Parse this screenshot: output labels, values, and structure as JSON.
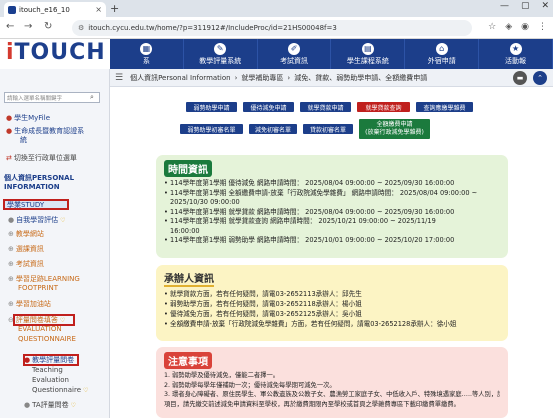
{
  "browser": {
    "tab_title": "itouch_e16_10",
    "url": "itouch.cycu.edu.tw/home/?p=311912#/IncludeProc/id=21HS00048f=3",
    "new_tab": "+",
    "win_min": "—",
    "win_max": "▢",
    "win_close": "✕"
  },
  "site": {
    "logo_i": "i",
    "logo_rest": "TOUCH",
    "nav": [
      {
        "label": "系",
        "icon": "▦"
      },
      {
        "label": "教學評量系統",
        "icon": "✎"
      },
      {
        "label": "考試資訊",
        "icon": "✐"
      },
      {
        "label": "學生課程系統",
        "icon": "▤"
      },
      {
        "label": "外宿申請",
        "icon": "⌂"
      },
      {
        "label": "活動報",
        "icon": "★"
      }
    ]
  },
  "sidebar": {
    "search_placeholder": "請輸入選單名稱關鍵字",
    "myfile": "學生MyFile",
    "portfolio_line1": "生命成長暨教育認證系",
    "portfolio_line2": "統",
    "switch_role": "切換至行政單位選單",
    "section_personal_1": "個人資訊PERSONAL",
    "section_personal_2": "INFORMATION",
    "study": "學業STUDY",
    "items": [
      "自我學習評估",
      "教學網站",
      "選課資訊",
      "考試資訊",
      "學習足跡LEARNING",
      "FOOTPRINT",
      "學習加油站",
      "評量問卷填答",
      "EVALUATION",
      "QUESTIONNAIRE",
      "教學評量問卷",
      "Teaching",
      "Evaluation",
      "Questionnaire",
      "TA評量問卷"
    ]
  },
  "main": {
    "breadcrumb": [
      "個人資訊Personal Information",
      "就學補助專區",
      "減免、貸款、弱勢助學申請、全額繳費申請"
    ],
    "buttons_row1": [
      "弱勢助學申請",
      "優待減免申請",
      "就學貸款申請",
      "就學貸款查詢",
      "查詢應繳學雜費"
    ],
    "buttons_row2": [
      "弱勢助學初審名單",
      "減免初審名單",
      "貸款初審名單"
    ],
    "green_button_line1": "全額繳費申請",
    "green_button_line2": "(放棄行政減免學雜費)",
    "time": {
      "title": "時間資訊",
      "lines": [
        "114學年度第1學期 優待減免 網路申請時間： 2025/08/04 09:00:00 ~ 2025/09/30 16:00:00",
        "114學年度第1學期 全額繳費申請-放棄「行政院減免學雜費」 網路申請時間： 2025/08/04 09:00:00 ~",
        "2025/10/30 09:00:00",
        "114學年度第1學期 就學貸款 網路申請時間： 2025/08/04 09:00:00 ~ 2025/09/30 16:00:00",
        "114學年度第1學期 就學貸款查詢 網路申請時間： 2025/10/21 09:00:00 ~ 2025/11/19",
        "16:00:00",
        "114學年度第1學期 弱勢助學 網路申請時間： 2025/10/01 09:00:00 ~ 2025/10/20 17:00:00"
      ]
    },
    "contact": {
      "title": "承辦人資訊",
      "lines": [
        "就學貸款方面，若有任何疑問，請電03-2652113承辦人：邱先生",
        "弱勢助學方面，若有任何疑問，請電03-2652118承辦人：楊小姐",
        "優待減免方面，若有任何疑問，請電03-2652125承辦人：吳小姐",
        "全額繳費申請-放棄「行政院減免學雜費」方面，若有任何疑問，請電03-2652128承辦人：徐小姐"
      ]
    },
    "notice": {
      "title": "注意事項",
      "lines": [
        "1. 弱勢助學及優待減免，僅能二者擇一。",
        "2. 弱勢助學每學年僅補助一次；優待減免每學期可減免一次。",
        "3. 環者身心障礙者、原住民學生、軍公教遺族及公教子女、農漁勞工家庭子女、中低收入戶、特殊境遇家庭…..等人別，請選擇申請方案，若有兩種以上身份別者",
        "項目，請先繳交前述減免申請資料至學校，再於繳費期限內至學校或首頁之學雜費專區下載印繳費單繳費。"
      ]
    }
  }
}
